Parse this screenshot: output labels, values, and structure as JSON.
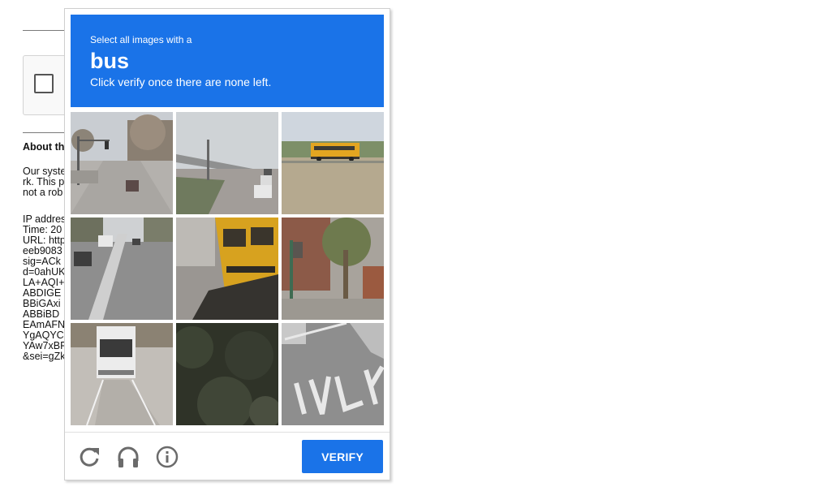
{
  "background_page": {
    "heading": "About th",
    "paragraph_lines": [
      "Our syste",
      "rk. This p",
      "not a rob"
    ],
    "detail_lines": [
      "IP addres",
      "Time: 20",
      "URL: http",
      "eeb9083",
      "sig=ACk",
      "d=0ahUK",
      "LA+AQI+",
      "ABDIGE",
      "BBiGAxi",
      "ABBiBD",
      "EAmAFN",
      "YgAQYC",
      "YAw7xBF",
      "&sei=gZk"
    ]
  },
  "challenge": {
    "instruction": "Select all images with a",
    "target": "bus",
    "subtext": "Click verify once there are none left.",
    "banner_color": "#1a73e8",
    "tiles": [
      {
        "scene": "street with trees and traffic lights",
        "selected": false
      },
      {
        "scene": "road with overpass and parked cars",
        "selected": false
      },
      {
        "scene": "school bus in open field",
        "selected": false
      },
      {
        "scene": "street with cars",
        "selected": false
      },
      {
        "scene": "rear of yellow school bus",
        "selected": false
      },
      {
        "scene": "palm tree and building",
        "selected": false
      },
      {
        "scene": "rear of white bus",
        "selected": false
      },
      {
        "scene": "dark shrubbery",
        "selected": false
      },
      {
        "scene": "road marking ONLY",
        "selected": false
      }
    ],
    "footer": {
      "reload_icon": "reload-icon",
      "audio_icon": "headphones-icon",
      "info_icon": "info-icon",
      "verify_label": "VERIFY"
    }
  }
}
